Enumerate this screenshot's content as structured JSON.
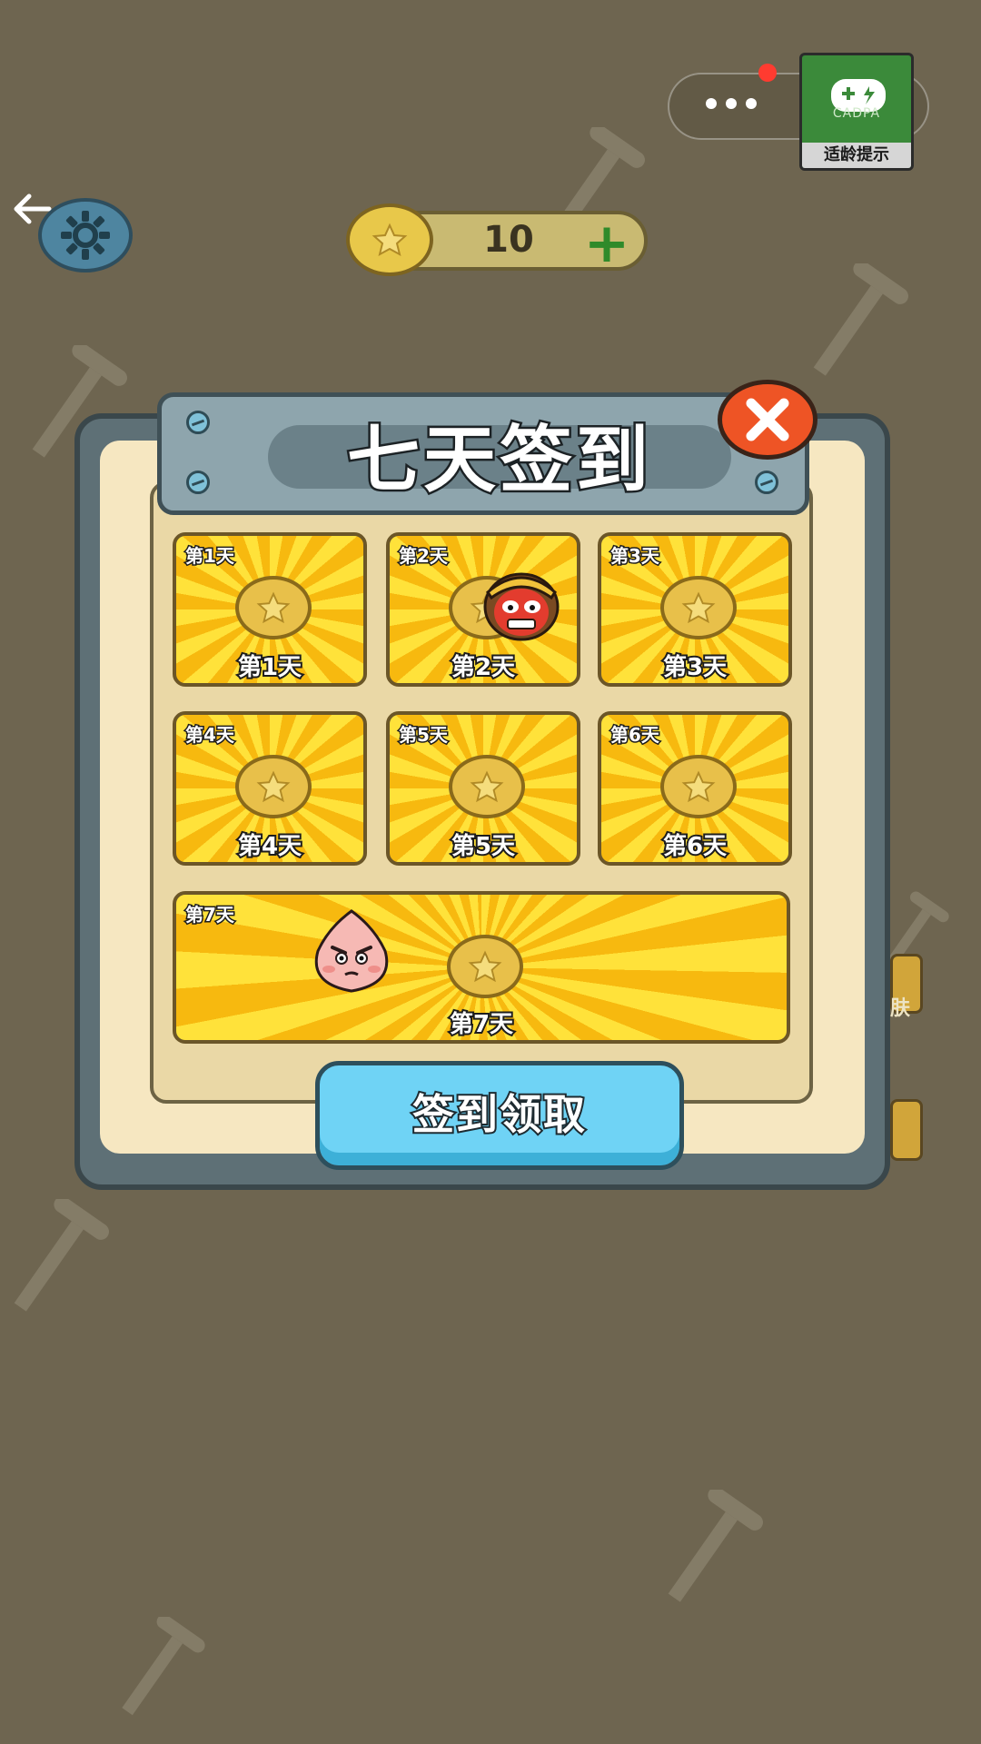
{
  "status_bar": {
    "age_rating_label": "适龄提示",
    "age_rating_org": "CADPA"
  },
  "currency": {
    "coins": "10",
    "add_label": "+"
  },
  "modal": {
    "title": "七天签到",
    "claim_button_label": "签到领取",
    "days": [
      {
        "tag": "第1天",
        "label": "第1天"
      },
      {
        "tag": "第2天",
        "label": "第2天"
      },
      {
        "tag": "第3天",
        "label": "第3天"
      },
      {
        "tag": "第4天",
        "label": "第4天"
      },
      {
        "tag": "第5天",
        "label": "第5天"
      },
      {
        "tag": "第6天",
        "label": "第6天"
      },
      {
        "tag": "第7天",
        "label": "第7天"
      }
    ]
  },
  "background": {
    "side_text_1": "肤"
  },
  "colors": {
    "background": "#6e6550",
    "card_yellow": "#ffe23a",
    "close_red": "#ee5425",
    "claim_blue": "#6fd3f5"
  },
  "icons": [
    "back-arrow-icon",
    "gear-icon",
    "coin-icon",
    "plus-icon",
    "close-icon",
    "more-dots-icon",
    "gamepad-icon",
    "monkey-mask-icon",
    "peach-face-icon"
  ]
}
